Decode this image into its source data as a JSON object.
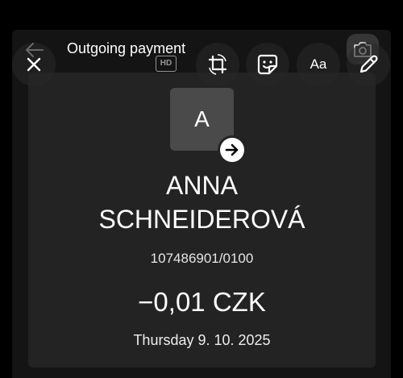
{
  "header": {
    "title": "Outgoing payment",
    "hd_label": "HD"
  },
  "toolbar": {
    "close_icon": "close-icon",
    "crop_icon": "crop-rotate-icon",
    "sticker_icon": "sticker-icon",
    "text_label": "Aa",
    "draw_icon": "pencil-icon",
    "camera_icon": "camera-switch-icon"
  },
  "payment": {
    "avatar_initial": "A",
    "direction_icon": "arrow-right-icon",
    "recipient_name_line1": "ANNA",
    "recipient_name_line2": "SCHNEIDEROVÁ",
    "account_number": "107486901/0100",
    "amount": "−0,01 CZK",
    "date": "Thursday 9. 10. 2025"
  },
  "colors": {
    "background": "#000000",
    "panel": "#141414",
    "card": "#232323",
    "avatar": "#4a4a4a",
    "text": "#ffffff"
  }
}
